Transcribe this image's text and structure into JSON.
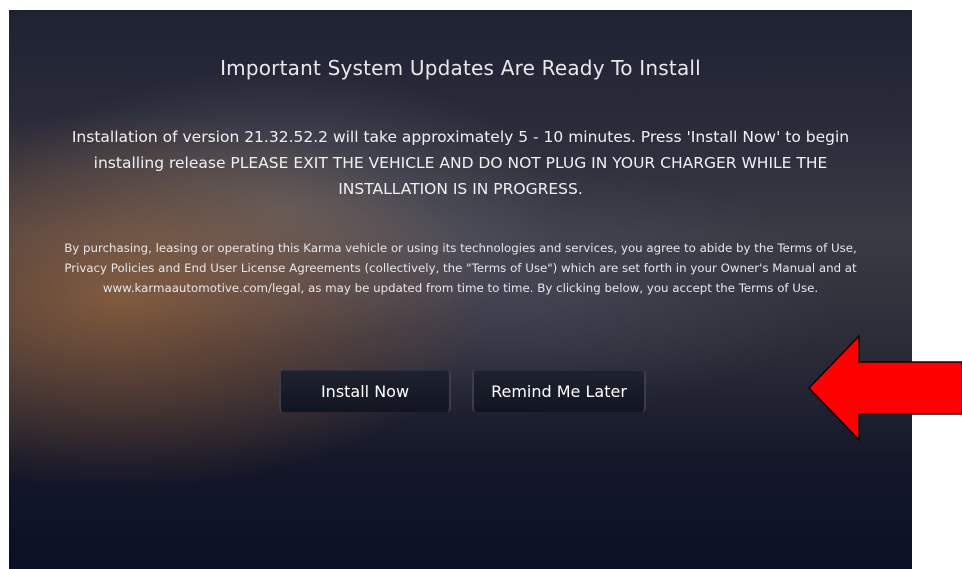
{
  "dialog": {
    "title": "Important System Updates Are Ready To Install",
    "message": "Installation of version 21.32.52.2 will take approximately 5 - 10 minutes. Press 'Install Now' to begin installing release   PLEASE EXIT THE VEHICLE AND DO NOT PLUG IN YOUR CHARGER WHILE THE INSTALLATION IS IN PROGRESS.",
    "legal": "By purchasing, leasing or operating this Karma vehicle or using its technologies and services, you agree to abide by the Terms of Use, Privacy Policies and End User License Agreements (collectively, the \"Terms of Use\") which are set forth in your Owner's Manual and at www.karmaautomotive.com/legal, as may be updated from time to time.  By clicking below, you accept the Terms of Use.",
    "buttons": {
      "install_label": "Install Now",
      "remind_label": "Remind Me Later"
    }
  },
  "annotation": {
    "icon": "arrow-left-icon",
    "color": "#ff0000"
  }
}
